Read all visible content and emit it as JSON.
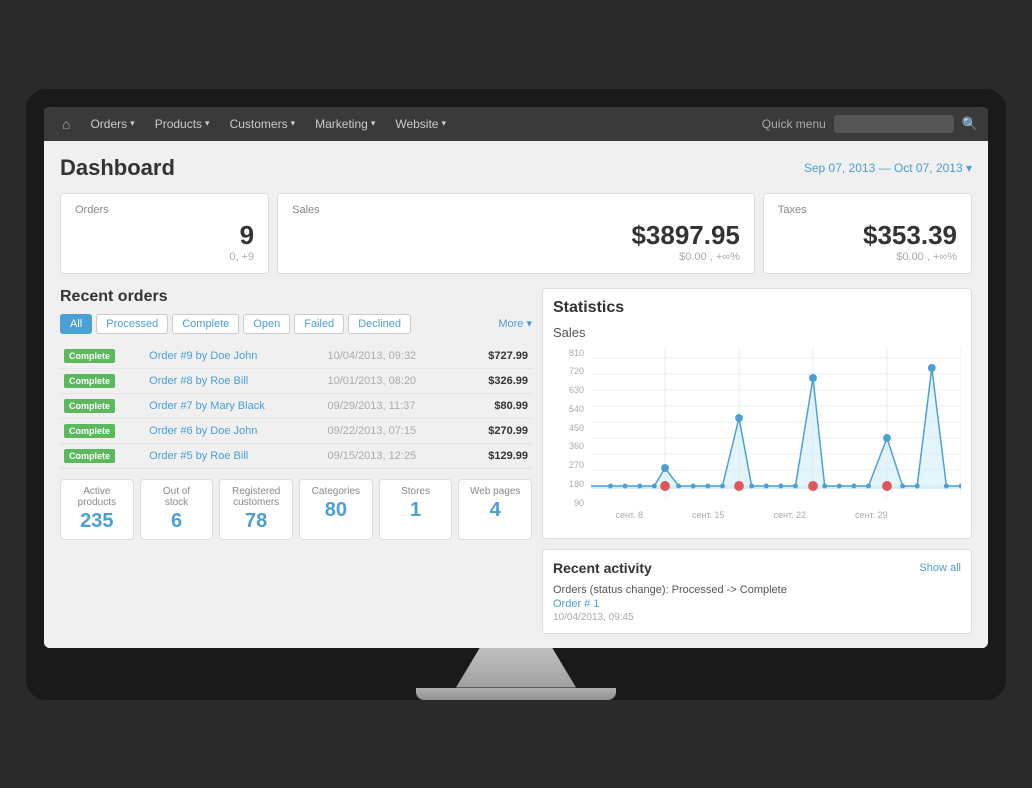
{
  "navbar": {
    "home_icon": "⌂",
    "items": [
      {
        "label": "Orders",
        "has_arrow": true
      },
      {
        "label": "Products",
        "has_arrow": true
      },
      {
        "label": "Customers",
        "has_arrow": true
      },
      {
        "label": "Marketing",
        "has_arrow": true
      },
      {
        "label": "Website",
        "has_arrow": true
      }
    ],
    "quick_menu": "Quick menu",
    "search_placeholder": ""
  },
  "header": {
    "title": "Dashboard",
    "date_range": "Sep 07, 2013 — Oct 07, 2013 ▾"
  },
  "stats": {
    "orders": {
      "label": "Orders",
      "value": "9",
      "sub": "0, +9"
    },
    "sales": {
      "label": "Sales",
      "value": "$3897.95",
      "sub": "$0.00 , +∞%"
    },
    "taxes": {
      "label": "Taxes",
      "value": "$353.39",
      "sub": "$0.00 , +∞%"
    }
  },
  "recent_orders": {
    "title": "Recent orders",
    "filters": [
      "All",
      "Processed",
      "Complete",
      "Open",
      "Failed",
      "Declined",
      "More ▾"
    ],
    "rows": [
      {
        "status": "Complete",
        "order": "Order #9 by Doe John",
        "date": "10/04/2013, 09:32",
        "amount": "$727.99"
      },
      {
        "status": "Complete",
        "order": "Order #8 by Roe Bill",
        "date": "10/01/2013, 08:20",
        "amount": "$326.99"
      },
      {
        "status": "Complete",
        "order": "Order #7 by Mary Black",
        "date": "09/29/2013, 11:37",
        "amount": "$80.99"
      },
      {
        "status": "Complete",
        "order": "Order #6 by Doe John",
        "date": "09/22/2013, 07:15",
        "amount": "$270.99"
      },
      {
        "status": "Complete",
        "order": "Order #5 by Roe Bill",
        "date": "09/15/2013, 12:25",
        "amount": "$129.99"
      }
    ]
  },
  "bottom_stats": [
    {
      "label": "Active products",
      "value": "235"
    },
    {
      "label": "Out of stock",
      "value": "6"
    },
    {
      "label": "Registered customers",
      "value": "78"
    },
    {
      "label": "Categories",
      "value": "80"
    },
    {
      "label": "Stores",
      "value": "1"
    },
    {
      "label": "Web pages",
      "value": "4"
    }
  ],
  "chart": {
    "title": "Statistics",
    "subtitle": "Sales",
    "y_labels": [
      "810",
      "720",
      "630",
      "540",
      "450",
      "360",
      "270",
      "180",
      "90"
    ],
    "x_labels": [
      "сент. 8",
      "сент. 15",
      "сент. 22",
      "сент. 29",
      ""
    ],
    "color_line": "#a8d8f0",
    "color_dot_blue": "#4a9fd4",
    "color_dot_red": "#e05555"
  },
  "recent_activity": {
    "title": "Recent activity",
    "show_all": "Show all",
    "items": [
      {
        "text": "Orders (status change): Processed -> Complete",
        "link": "Order # 1",
        "date": "10/04/2013, 09:45"
      }
    ]
  }
}
